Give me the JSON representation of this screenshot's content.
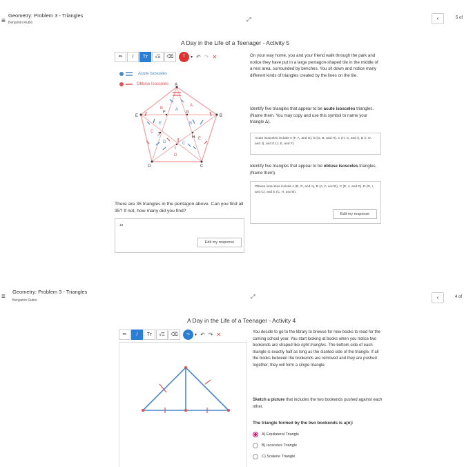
{
  "panel1": {
    "header": {
      "title": "Geometry: Problem 3 - Triangles",
      "subtitle": "Benjamin Rubio",
      "page_count": "5 of"
    },
    "activity_title": "A Day in the Life of a Teenager - Activity 5",
    "toolbar": {
      "pencil": "✏",
      "line": "/",
      "text": "Tт",
      "equation": "√Ξ",
      "eraser": "⌫",
      "color_label": "T",
      "color_value": "#e03030",
      "caret": "▾",
      "undo": "↶",
      "redo": "↷",
      "clear": "✕"
    },
    "legend": {
      "acute_label": "Acute Isosceles",
      "acute_color": "#4a86c8",
      "obtuse_label": "Obtuse Isosceles",
      "obtuse_color": "#e05050"
    },
    "pentagon_labels": {
      "A": "A",
      "B": "B",
      "C": "C",
      "D": "D",
      "E": "E",
      "F": "F",
      "G": "G",
      "H": "H",
      "I": "I",
      "J": "J"
    },
    "tri_labels_acute": [
      "A",
      "B",
      "C",
      "D",
      "E"
    ],
    "tri_labels_obtuse": [
      "A",
      "B",
      "C",
      "D",
      "E"
    ],
    "intro_text": "On your way home, you and your friend walk through the park and notice they have put in a large pentagon-shaped tile in the middle of a rest area, surrounded by benches. You sit down and notice many different kinds of triangles created by the lines on the tile.",
    "q_acute_pre": "Identify five triangles that appear to be ",
    "q_acute_bold": "acute isosceles",
    "q_acute_post": " triangles. (Name them. You may copy and use this symbol to name your triangle Δ).",
    "answer_acute": "Acute isosceles include A (F, A, and G), B (G, B, and H), C (H, C, and I), D (I, D, and J), and E (J, E, and F).",
    "q_obtuse_pre": "Identify five triangles that appear to be ",
    "q_obtuse_bold": "obtuse isosceles",
    "q_obtuse_post": " triangles. (Name them).",
    "answer_obtuse": "Obtuse isosceles include A (B, G, and A), B (A, F, and E), C (E, J, and D), D (D, I, and C), and E (C, H, and B).",
    "edit_response": "Edit my response",
    "count_question": "There are 35 triangles in the pentagon above.  Can you find all 35?  If not, how many did you find?",
    "count_answer": "19",
    "edit_response_2": "Edit my response"
  },
  "panel2": {
    "header": {
      "title": "Geometry: Problem 3 - Triangles",
      "subtitle": "Benjamin Rubio",
      "page_count": "4 of"
    },
    "activity_title": "A Day in the Life of a Teenager - Activity 4",
    "toolbar": {
      "pencil": "✏",
      "line": "/",
      "text": "Tт",
      "equation": "√Ξ",
      "eraser": "⌫",
      "color_label": "↷",
      "color_value": "#2a7fd4",
      "caret": "▾",
      "undo": "↶",
      "redo": "↷",
      "clear": "✕"
    },
    "story_pre": "You decide to go to the library to browse for new books to read for the coming school year. You start looking at books when you notice two bookends are shaped like ",
    "story_em": "right triangles",
    "story_post": ". The bottom side of each triangle is exactly half as long as the slanted side of the triangle. If all the books between the bookends are removed and they are pushed together, they will form a single triangle.",
    "sketch_bold": "Sketch a picture",
    "sketch_post": " that includes the two bookends pushed against each other.",
    "mc_question": "The triangle formed by the two bookends is a(n):",
    "options": [
      {
        "label": "A) Equilateral Triangle",
        "selected": true
      },
      {
        "label": "B) Isosceles Triangle",
        "selected": false
      },
      {
        "label": "C) Scalene Triangle",
        "selected": false
      }
    ]
  }
}
